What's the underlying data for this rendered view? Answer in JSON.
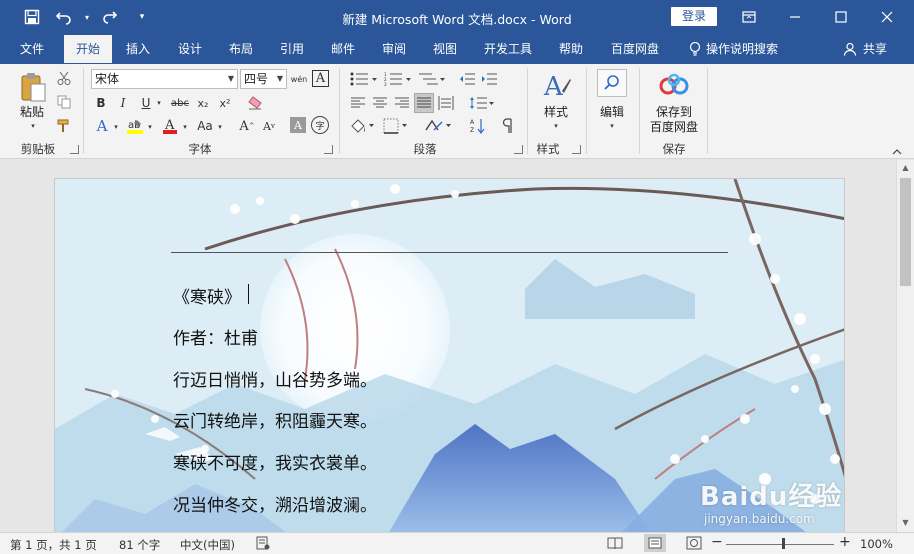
{
  "window": {
    "title": "新建 Microsoft Word 文档.docx  -  Word",
    "login_label": "登录"
  },
  "ribbon_tabs": [
    {
      "label": "文件"
    },
    {
      "label": "开始"
    },
    {
      "label": "插入"
    },
    {
      "label": "设计"
    },
    {
      "label": "布局"
    },
    {
      "label": "引用"
    },
    {
      "label": "邮件"
    },
    {
      "label": "审阅"
    },
    {
      "label": "视图"
    },
    {
      "label": "开发工具"
    },
    {
      "label": "帮助"
    },
    {
      "label": "百度网盘"
    },
    {
      "label": "操作说明搜索"
    },
    {
      "label": "共享"
    }
  ],
  "ribbon": {
    "paste_label": "粘贴",
    "font_name": "宋体",
    "font_size": "四号",
    "styles_label": "样式",
    "edit_label": "编辑",
    "save_baidu_line1": "保存到",
    "save_baidu_line2": "百度网盘",
    "groups": {
      "clipboard": "剪贴板",
      "font": "字体",
      "paragraph": "段落",
      "styles": "样式",
      "save": "保存"
    },
    "font_buttons": {
      "bold": "B",
      "italic": "I",
      "underline": "U",
      "strike": "abc",
      "subscript": "x₂",
      "superscript": "x²",
      "change_case": "Aa",
      "grow": "A",
      "shrink": "A",
      "wen": "wén",
      "border_char": "A",
      "shade_char": "A",
      "enclose": "字"
    }
  },
  "document": {
    "lines": [
      "《寒硖》",
      "作者：杜甫",
      "行迈日悄悄，山谷势多端。",
      "云门转绝岸，积阻霾天寒。",
      "寒硖不可度，我实衣裳单。",
      "况当仲冬交，溯沿增波澜。"
    ]
  },
  "statusbar": {
    "page": "第 1 页，共 1 页",
    "words": "81 个字",
    "language": "中文(中国)",
    "zoom": "100%",
    "zoom_minus": "−",
    "zoom_plus": "+"
  },
  "watermark": {
    "text": "Baidu经验",
    "sub": "jingyan.baidu.com"
  },
  "colors": {
    "accent": "#2b579a",
    "ribbon_bg": "#f3f3f3",
    "highlight_yellow": "#ffff00",
    "font_red": "#e02020"
  }
}
